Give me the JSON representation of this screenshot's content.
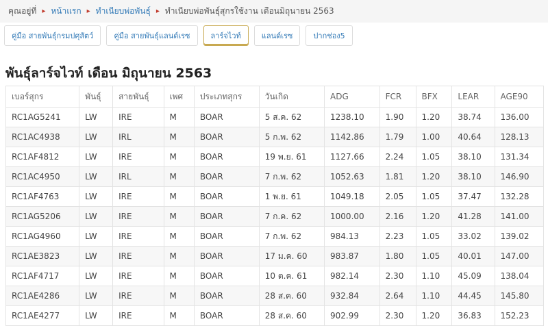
{
  "breadcrumb": {
    "items": [
      "คุณอยู่ที่",
      "หน้าแรก",
      "ทำเนียบพ่อพันธุ์"
    ],
    "current": "ทำเนียบพ่อพันธุ์สุกรใช้งาน เดือนมิถุนายน 2563",
    "separator": "▸"
  },
  "tabs": [
    {
      "label": "คู่มือ สายพันธุ์กรมปศุสัตว์",
      "active": false
    },
    {
      "label": "คู่มือ สายพันธุ์แลนด์เรซ",
      "active": false
    },
    {
      "label": "ลาร์จไวท์",
      "active": true
    },
    {
      "label": "แลนด์เรซ",
      "active": false
    },
    {
      "label": "ปากช่อง5",
      "active": false
    }
  ],
  "page_title": "พันธุ์ลาร์จไวท์ เดือน มิถุนายน 2563",
  "table": {
    "headers": [
      "เบอร์สุกร",
      "พันธุ์",
      "สายพันธุ์",
      "เพศ",
      "ประเภทสุกร",
      "วันเกิด",
      "ADG",
      "FCR",
      "BFX",
      "LEAR",
      "AGE90"
    ],
    "rows": [
      [
        "RC1AG5241",
        "LW",
        "IRE",
        "M",
        "BOAR",
        "5 ส.ค. 62",
        "1238.10",
        "1.90",
        "1.20",
        "38.74",
        "136.00"
      ],
      [
        "RC1AC4938",
        "LW",
        "IRL",
        "M",
        "BOAR",
        "5 ก.พ. 62",
        "1142.86",
        "1.79",
        "1.00",
        "40.64",
        "128.13"
      ],
      [
        "RC1AF4812",
        "LW",
        "IRE",
        "M",
        "BOAR",
        "19 พ.ย. 61",
        "1127.66",
        "2.24",
        "1.05",
        "38.10",
        "131.34"
      ],
      [
        "RC1AC4950",
        "LW",
        "IRL",
        "M",
        "BOAR",
        "7 ก.พ. 62",
        "1052.63",
        "1.81",
        "1.20",
        "38.10",
        "146.90"
      ],
      [
        "RC1AF4763",
        "LW",
        "IRE",
        "M",
        "BOAR",
        "1 พ.ย. 61",
        "1049.18",
        "2.05",
        "1.05",
        "37.47",
        "132.28"
      ],
      [
        "RC1AG5206",
        "LW",
        "IRE",
        "M",
        "BOAR",
        "7 ก.ค. 62",
        "1000.00",
        "2.16",
        "1.20",
        "41.28",
        "141.00"
      ],
      [
        "RC1AG4960",
        "LW",
        "IRE",
        "M",
        "BOAR",
        "7 ก.พ. 62",
        "984.13",
        "2.23",
        "1.05",
        "33.02",
        "139.02"
      ],
      [
        "RC1AE3823",
        "LW",
        "IRE",
        "M",
        "BOAR",
        "17 ม.ค. 60",
        "983.87",
        "1.80",
        "1.05",
        "40.01",
        "147.00"
      ],
      [
        "RC1AF4717",
        "LW",
        "IRE",
        "M",
        "BOAR",
        "10 ต.ค. 61",
        "982.14",
        "2.30",
        "1.10",
        "45.09",
        "138.04"
      ],
      [
        "RC1AE4286",
        "LW",
        "IRE",
        "M",
        "BOAR",
        "28 ส.ค. 60",
        "932.84",
        "2.64",
        "1.10",
        "44.45",
        "145.80"
      ],
      [
        "RC1AE4277",
        "LW",
        "IRE",
        "M",
        "BOAR",
        "28 ส.ค. 60",
        "902.99",
        "2.30",
        "1.20",
        "36.83",
        "152.23"
      ]
    ]
  }
}
